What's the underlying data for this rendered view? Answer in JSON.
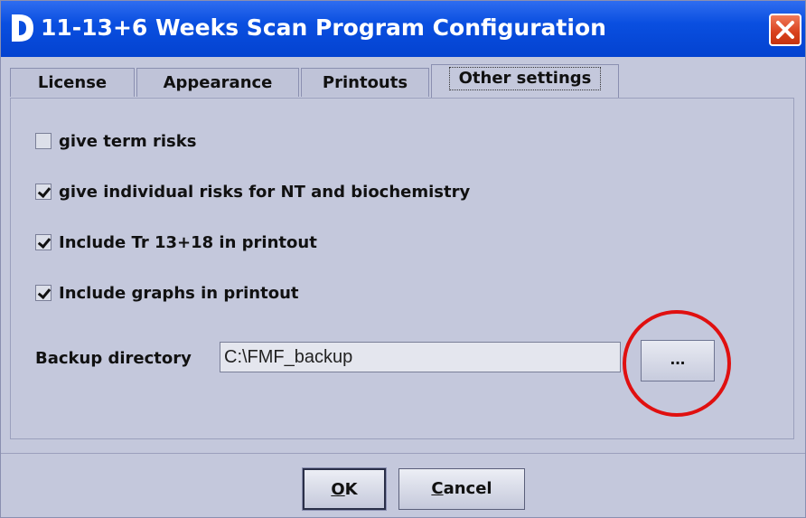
{
  "window": {
    "title": "11-13+6 Weeks Scan Program Configuration",
    "close_glyph": "✕"
  },
  "tabs": [
    {
      "label": "License",
      "active": false
    },
    {
      "label": "Appearance",
      "active": false
    },
    {
      "label": "Printouts",
      "active": false
    },
    {
      "label": "Other settings",
      "active": true
    }
  ],
  "settings": {
    "checkboxes": [
      {
        "label": "give term risks",
        "checked": false
      },
      {
        "label": "give individual risks for NT and biochemistry",
        "checked": true
      },
      {
        "label": "Include Tr 13+18 in printout",
        "checked": true
      },
      {
        "label": "Include graphs in printout",
        "checked": true
      }
    ],
    "backup": {
      "label": "Backup directory",
      "value": "C:\\FMF_backup",
      "browse_label": "..."
    }
  },
  "buttons": {
    "ok_mnemonic": "O",
    "ok_rest": "K",
    "cancel_mnemonic": "C",
    "cancel_rest": "ancel"
  },
  "colors": {
    "titlebar": "#0a4fe0",
    "dialog_bg": "#c4c8dc",
    "highlight_ring": "#e01010"
  }
}
